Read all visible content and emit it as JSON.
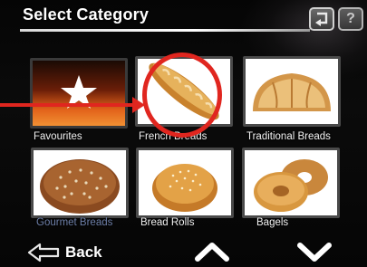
{
  "header": {
    "title": "Select Category",
    "back_icon": "return-arrow-icon",
    "help_label": "?"
  },
  "categories": [
    {
      "label": "Favourites",
      "icon": "star-icon"
    },
    {
      "label": "French Breads",
      "icon": "baguette-image"
    },
    {
      "label": "Traditional Breads",
      "icon": "loaf-image"
    },
    {
      "label": "Gourmet Breads",
      "icon": "round-seeded-bread-image"
    },
    {
      "label": "Bread Rolls",
      "icon": "bread-roll-image"
    },
    {
      "label": "Bagels",
      "icon": "bagels-image"
    }
  ],
  "footer": {
    "back_label": "Back",
    "up_icon": "chevron-up-icon",
    "down_icon": "chevron-down-icon"
  },
  "colors": {
    "annotation": "#e0261f",
    "background": "#000000",
    "text": "#ffffff",
    "label_dim": "#6d7fa8"
  }
}
